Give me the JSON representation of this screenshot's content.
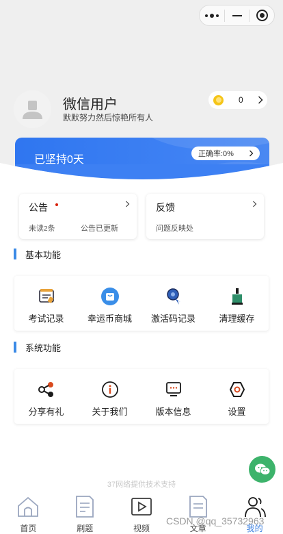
{
  "window": {
    "capsule": {
      "more_icon": "more-dots-icon",
      "minimize_icon": "minimize-icon",
      "close_icon": "target-close-icon"
    }
  },
  "profile": {
    "name": "微信用户",
    "motto": "默默努力然后惊艳所有人",
    "avatar_icon": "default-avatar-icon",
    "coins": "0"
  },
  "banner": {
    "streak_text": "已坚持0天",
    "accuracy_text": "正确率:0%",
    "color": "#2f76f0"
  },
  "notice": {
    "title": "公告",
    "unread_prefix": "未读",
    "unread_count": "2",
    "unread_suffix": "条",
    "status": "公告已更新"
  },
  "feedback": {
    "title": "反馈",
    "subtitle": "问题反映处"
  },
  "basic_section": {
    "title": "基本功能",
    "items": [
      {
        "label": "考试记录",
        "icon": "exam-record-icon"
      },
      {
        "label": "幸运币商城",
        "icon": "coin-mall-icon"
      },
      {
        "label": "激活码记录",
        "icon": "activation-code-icon"
      },
      {
        "label": "清理缓存",
        "icon": "clear-cache-icon"
      }
    ]
  },
  "system_section": {
    "title": "系统功能",
    "items": [
      {
        "label": "分享有礼",
        "icon": "share-icon"
      },
      {
        "label": "关于我们",
        "icon": "about-icon"
      },
      {
        "label": "版本信息",
        "icon": "version-icon"
      },
      {
        "label": "设置",
        "icon": "settings-icon"
      }
    ]
  },
  "support_text": "37网络提供技术支持",
  "tabbar": {
    "items": [
      {
        "label": "首页",
        "icon": "home-icon"
      },
      {
        "label": "刷题",
        "icon": "practice-icon"
      },
      {
        "label": "视频",
        "icon": "video-icon"
      },
      {
        "label": "文章",
        "icon": "article-icon"
      },
      {
        "label": "我的",
        "icon": "profile-icon",
        "active": true
      }
    ],
    "active_color": "#3b7fe0"
  },
  "watermark": "CSDN @qq_35732963"
}
